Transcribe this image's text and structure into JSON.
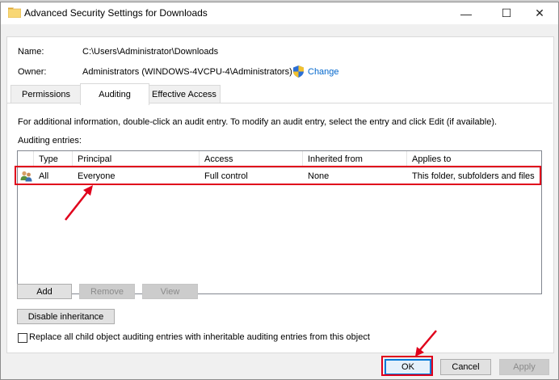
{
  "window": {
    "title": "Advanced Security Settings for Downloads",
    "minimize_glyph": "—",
    "maximize_glyph": "☐",
    "close_glyph": "✕"
  },
  "info": {
    "name_label": "Name:",
    "name_value": "C:\\Users\\Administrator\\Downloads",
    "owner_label": "Owner:",
    "owner_value": "Administrators (WINDOWS-4VCPU-4\\Administrators)",
    "change_label": "Change"
  },
  "tabs": [
    {
      "label": "Permissions",
      "active": false
    },
    {
      "label": "Auditing",
      "active": true
    },
    {
      "label": "Effective Access",
      "active": false
    }
  ],
  "auditing": {
    "instructions": "For additional information, double-click an audit entry. To modify an audit entry, select the entry and click Edit (if available).",
    "entries_label": "Auditing entries:",
    "columns": [
      "Type",
      "Principal",
      "Access",
      "Inherited from",
      "Applies to"
    ],
    "rows": [
      {
        "type": "All",
        "principal": "Everyone",
        "access": "Full control",
        "inherited_from": "None",
        "applies_to": "This folder, subfolders and files"
      }
    ]
  },
  "buttons": {
    "add": "Add",
    "remove": "Remove",
    "view": "View",
    "disable_inheritance": "Disable inheritance",
    "ok": "OK",
    "cancel": "Cancel",
    "apply": "Apply"
  },
  "checkbox": {
    "label": "Replace all child object auditing entries with inheritable auditing entries from this object",
    "checked": false
  },
  "colors": {
    "annotation_red": "#e0001b",
    "link_blue": "#0066cc",
    "focus_blue": "#0078d7"
  }
}
